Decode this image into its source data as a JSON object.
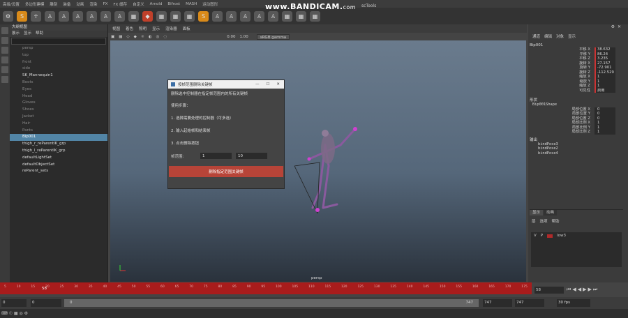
{
  "menubar": [
    "高级/设置",
    "多边形建模",
    "雕刻",
    "装备",
    "动画",
    "渲染",
    "FX",
    "FX 缓存",
    "自定义",
    "Arnold",
    "Bifrost",
    "MASH",
    "运动图形",
    "TURTLE",
    "XGen"
  ],
  "watermark": {
    "main": "www.BANDICAM.",
    "suffix": "com"
  },
  "shelf_extra": "scTools",
  "outliner": {
    "title": "大纲视图",
    "menu": [
      "展示",
      "显示",
      "帮助"
    ],
    "items": [
      {
        "label": "persp",
        "dim": true
      },
      {
        "label": "top",
        "dim": true
      },
      {
        "label": "front",
        "dim": true
      },
      {
        "label": "side",
        "dim": true
      },
      {
        "label": "SK_Mannequin1",
        "dim": false
      },
      {
        "label": "Boots",
        "dim": true
      },
      {
        "label": "Eyes",
        "dim": true
      },
      {
        "label": "Head",
        "dim": true
      },
      {
        "label": "Gloves",
        "dim": true
      },
      {
        "label": "Shoes",
        "dim": true
      },
      {
        "label": "Jacket",
        "dim": true
      },
      {
        "label": "Hair",
        "dim": true
      },
      {
        "label": "Pants",
        "dim": true
      },
      {
        "label": "Bip001",
        "dim": false,
        "selected": true
      },
      {
        "label": "thigh_r_reParentIK_grp",
        "dim": false
      },
      {
        "label": "thigh_l_reParentIK_grp",
        "dim": false
      },
      {
        "label": "defaultLightSet",
        "dim": false
      },
      {
        "label": "defaultObjectSet",
        "dim": false
      },
      {
        "label": "reParent_sets",
        "dim": false
      }
    ]
  },
  "viewport": {
    "menu": [
      "视图",
      "着色",
      "照明",
      "显示",
      "渲染器",
      "面板"
    ],
    "gamma_value": "0.00",
    "exposure_value": "1.00",
    "color_space": "sRGB gamma",
    "camera": "persp"
  },
  "dialog": {
    "title": "按帧范围删除关键帧",
    "description": "删除选中控制器在指定帧范围内的所有关键帧",
    "steps_title": "使用步骤：",
    "steps": [
      "1. 选择需要处理的控制器（可多选）",
      "2. 输入起始帧和结束帧",
      "3. 点击删除按钮"
    ],
    "frame_label": "帧范围:",
    "start_frame": "1",
    "end_frame": "10",
    "button": "删除指定范围关键帧",
    "accent": "#b74438"
  },
  "channelbox": {
    "menu": [
      "通道",
      "编辑",
      "对象",
      "显示"
    ],
    "object": "Bip001",
    "attrs": [
      {
        "label": "平移 X",
        "value": "38.632"
      },
      {
        "label": "平移 Y",
        "value": "86.24"
      },
      {
        "label": "平移 Z",
        "value": "3.235"
      },
      {
        "label": "旋转 X",
        "value": "27.157"
      },
      {
        "label": "旋转 Y",
        "value": "-72.901"
      },
      {
        "label": "旋转 Z",
        "value": "-112.529"
      },
      {
        "label": "缩放 X",
        "value": "1"
      },
      {
        "label": "缩放 Y",
        "value": "1"
      },
      {
        "label": "缩放 Z",
        "value": "1"
      },
      {
        "label": "可见性",
        "value": "启用"
      }
    ],
    "shapes_label": "形状",
    "shape": "Bip001Shape",
    "shape_attrs": [
      {
        "label": "局部位置 X",
        "value": "0"
      },
      {
        "label": "局部位置 Y",
        "value": "0"
      },
      {
        "label": "局部位置 Z",
        "value": "0"
      },
      {
        "label": "局部比例 X",
        "value": "1"
      },
      {
        "label": "局部比例 Y",
        "value": "1"
      },
      {
        "label": "局部比例 Z",
        "value": "1"
      }
    ],
    "outputs_label": "输出",
    "outputs": [
      "bindPose3",
      "bindPose2",
      "bindPose4"
    ]
  },
  "layers": {
    "tabs": [
      "显示",
      "动画"
    ],
    "menu": [
      "层",
      "选项",
      "帮助"
    ],
    "row": {
      "v": "V",
      "p": "P",
      "name": "low3"
    }
  },
  "timeline": {
    "ticks": [
      "5",
      "10",
      "15",
      "20",
      "25",
      "30",
      "35",
      "40",
      "45",
      "50",
      "55",
      "60",
      "65",
      "70",
      "75",
      "80",
      "85",
      "90",
      "95",
      "100",
      "105",
      "110",
      "115",
      "120",
      "125",
      "130",
      "135",
      "140",
      "145",
      "150",
      "155",
      "160",
      "165",
      "170",
      "175"
    ],
    "current": "58",
    "field": "58"
  },
  "range": {
    "start": "0",
    "inner_start": "0",
    "slider_start": "0",
    "slider_end": "747",
    "inner_end": "747",
    "end": "747",
    "fps": "30 fps"
  }
}
